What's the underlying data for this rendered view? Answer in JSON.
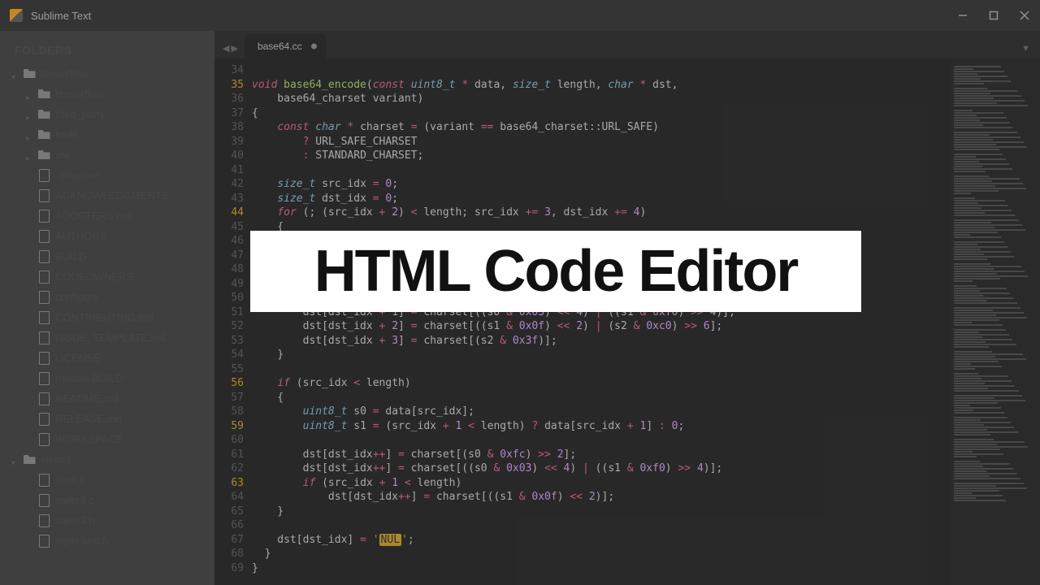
{
  "app": {
    "title": "Sublime Text"
  },
  "sidebar": {
    "title": "FOLDERS",
    "items": [
      {
        "label": "tensorflow",
        "type": "folder",
        "depth": 0,
        "expanded": true
      },
      {
        "label": "tensorflow",
        "type": "folder",
        "depth": 1,
        "expanded": false
      },
      {
        "label": "third_party",
        "type": "folder",
        "depth": 1,
        "expanded": false
      },
      {
        "label": "tools",
        "type": "folder",
        "depth": 1,
        "expanded": false
      },
      {
        "label": "util",
        "type": "folder",
        "depth": 1,
        "expanded": false
      },
      {
        "label": ".gitignore",
        "type": "file",
        "depth": 1
      },
      {
        "label": "ACKNOWLEDGMENTS",
        "type": "file",
        "depth": 1
      },
      {
        "label": "ADOPTERS.md",
        "type": "file",
        "depth": 1
      },
      {
        "label": "AUTHORS",
        "type": "file",
        "depth": 1
      },
      {
        "label": "BUILD",
        "type": "file",
        "depth": 1
      },
      {
        "label": "CODEOWNERS",
        "type": "file",
        "depth": 1
      },
      {
        "label": "configure",
        "type": "file",
        "depth": 1
      },
      {
        "label": "CONTRIBUTING.md",
        "type": "file",
        "depth": 1
      },
      {
        "label": "ISSUE_TEMPLATE.md",
        "type": "file",
        "depth": 1
      },
      {
        "label": "LICENSE",
        "type": "file",
        "depth": 1
      },
      {
        "label": "models.BUILD",
        "type": "file",
        "depth": 1
      },
      {
        "label": "README.md",
        "type": "file",
        "depth": 1
      },
      {
        "label": "RELEASE.md",
        "type": "file",
        "depth": 1
      },
      {
        "label": "WORKSPACE",
        "type": "file",
        "depth": 1
      },
      {
        "label": "sqlite3",
        "type": "folder",
        "depth": 0,
        "expanded": true
      },
      {
        "label": "shell.c",
        "type": "file",
        "depth": 1
      },
      {
        "label": "sqlite3.c",
        "type": "file",
        "depth": 1
      },
      {
        "label": "sqlite3.h",
        "type": "file",
        "depth": 1
      },
      {
        "label": "sqlite3ext.h",
        "type": "file",
        "depth": 1
      }
    ]
  },
  "tabs": {
    "active": {
      "label": "base64.cc",
      "dirty": true
    }
  },
  "editor": {
    "first_line": 34,
    "marked_lines": [
      35,
      44,
      56,
      59,
      63
    ],
    "lines": [
      {
        "n": 34,
        "html": ""
      },
      {
        "n": 35,
        "html": "<span class='kw'>void</span> <span class='fn'>base64_encode</span>(<span class='kw'>const</span> <span class='typ'>uint8_t</span> <span class='op'>*</span> data, <span class='typ'>size_t</span> length, <span class='typ'>char</span> <span class='op'>*</span> dst,"
      },
      {
        "n": 36,
        "html": "    base64_charset variant)"
      },
      {
        "n": 37,
        "html": "{"
      },
      {
        "n": 38,
        "html": "    <span class='kw'>const</span> <span class='typ'>char</span> <span class='op'>*</span> charset <span class='op'>=</span> (variant <span class='op'>==</span> base64_charset::URL_SAFE)"
      },
      {
        "n": 39,
        "html": "        <span class='op'>?</span> URL_SAFE_CHARSET"
      },
      {
        "n": 40,
        "html": "        <span class='op'>:</span> STANDARD_CHARSET;"
      },
      {
        "n": 41,
        "html": ""
      },
      {
        "n": 42,
        "html": "    <span class='typ'>size_t</span> src_idx <span class='op'>=</span> <span class='num'>0</span>;"
      },
      {
        "n": 43,
        "html": "    <span class='typ'>size_t</span> dst_idx <span class='op'>=</span> <span class='num'>0</span>;"
      },
      {
        "n": 44,
        "html": "    <span class='kw'>for</span> (; (src_idx <span class='op'>+</span> <span class='num'>2</span>) <span class='op'>&lt;</span> length; src_idx <span class='op'>+=</span> <span class='num'>3</span>, dst_idx <span class='op'>+=</span> <span class='num'>4</span>)"
      },
      {
        "n": 45,
        "html": "    {"
      },
      {
        "n": 46,
        "html": ""
      },
      {
        "n": 47,
        "html": ""
      },
      {
        "n": 48,
        "html": ""
      },
      {
        "n": 49,
        "html": ""
      },
      {
        "n": 50,
        "html": ""
      },
      {
        "n": 51,
        "html": "        dst[dst_idx <span class='op'>+</span> <span class='num'>1</span>] <span class='op'>=</span> charset[((s0 <span class='op'>&amp;</span> <span class='num'>0x03</span>) <span class='op'>&lt;&lt;</span> <span class='num'>4</span>) <span class='op'>|</span> ((s1 <span class='op'>&amp;</span> <span class='num'>0xf0</span>) <span class='op'>&gt;&gt;</span> <span class='num'>4</span>)];"
      },
      {
        "n": 52,
        "html": "        dst[dst_idx <span class='op'>+</span> <span class='num'>2</span>] <span class='op'>=</span> charset[((s1 <span class='op'>&amp;</span> <span class='num'>0x0f</span>) <span class='op'>&lt;&lt;</span> <span class='num'>2</span>) <span class='op'>|</span> (s2 <span class='op'>&amp;</span> <span class='num'>0xc0</span>) <span class='op'>&gt;&gt;</span> <span class='num'>6</span>];"
      },
      {
        "n": 53,
        "html": "        dst[dst_idx <span class='op'>+</span> <span class='num'>3</span>] <span class='op'>=</span> charset[(s2 <span class='op'>&amp;</span> <span class='num'>0x3f</span>)];"
      },
      {
        "n": 54,
        "html": "    }"
      },
      {
        "n": 55,
        "html": ""
      },
      {
        "n": 56,
        "html": "    <span class='kw'>if</span> (src_idx <span class='op'>&lt;</span> length)"
      },
      {
        "n": 57,
        "html": "    {"
      },
      {
        "n": 58,
        "html": "        <span class='typ'>uint8_t</span> s0 <span class='op'>=</span> data[src_idx];"
      },
      {
        "n": 59,
        "html": "        <span class='typ'>uint8_t</span> s1 <span class='op'>=</span> (src_idx <span class='op'>+</span> <span class='num'>1</span> <span class='op'>&lt;</span> length) <span class='op'>?</span> data[src_idx <span class='op'>+</span> <span class='num'>1</span>] <span class='op'>:</span> <span class='num'>0</span>;"
      },
      {
        "n": 60,
        "html": ""
      },
      {
        "n": 61,
        "html": "        dst[dst_idx<span class='op'>++</span>] <span class='op'>=</span> charset[(s0 <span class='op'>&amp;</span> <span class='num'>0xfc</span>) <span class='op'>&gt;&gt;</span> <span class='num'>2</span>];"
      },
      {
        "n": 62,
        "html": "        dst[dst_idx<span class='op'>++</span>] <span class='op'>=</span> charset[((s0 <span class='op'>&amp;</span> <span class='num'>0x03</span>) <span class='op'>&lt;&lt;</span> <span class='num'>4</span>) <span class='op'>|</span> ((s1 <span class='op'>&amp;</span> <span class='num'>0xf0</span>) <span class='op'>&gt;&gt;</span> <span class='num'>4</span>)];"
      },
      {
        "n": 63,
        "html": "        <span class='kw'>if</span> (src_idx <span class='op'>+</span> <span class='num'>1</span> <span class='op'>&lt;</span> length)"
      },
      {
        "n": 64,
        "html": "            dst[dst_idx<span class='op'>++</span>] <span class='op'>=</span> charset[((s1 <span class='op'>&amp;</span> <span class='num'>0x0f</span>) <span class='op'>&lt;&lt;</span> <span class='num'>2</span>)];"
      },
      {
        "n": 65,
        "html": "    }"
      },
      {
        "n": 66,
        "html": ""
      },
      {
        "n": 67,
        "html": "    dst[dst_idx] <span class='op'>=</span> <span class='str'>'</span><span class='strbg'>NUL</span><span class='str'>'</span>;"
      },
      {
        "n": 68,
        "html": "  }"
      },
      {
        "n": 69,
        "html": "}"
      }
    ]
  },
  "overlay": {
    "text": "HTML Code Editor"
  }
}
